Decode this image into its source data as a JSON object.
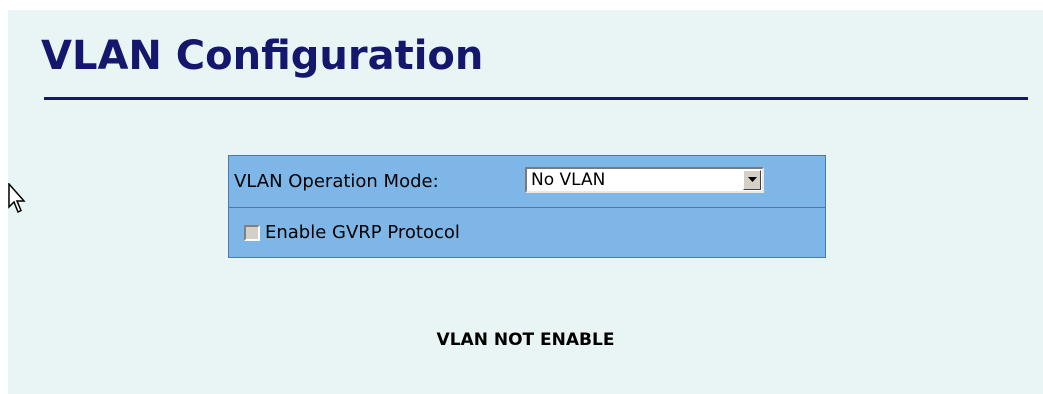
{
  "page": {
    "title": "VLAN Configuration",
    "status_text": "VLAN NOT ENABLE"
  },
  "vlan_mode": {
    "label": "VLAN Operation Mode:",
    "selected_value": "No VLAN",
    "dropdown_icon": "chevron-down-icon"
  },
  "gvrp": {
    "label": "Enable GVRP Protocol",
    "checked": false
  },
  "colors": {
    "title": "#14176b",
    "page_background": "#e9f5f5",
    "panel_background": "#7eb6e8",
    "panel_border": "#4a78b0"
  },
  "icons": {
    "cursor": "mouse-pointer-icon",
    "checkbox": "checkbox-icon"
  }
}
